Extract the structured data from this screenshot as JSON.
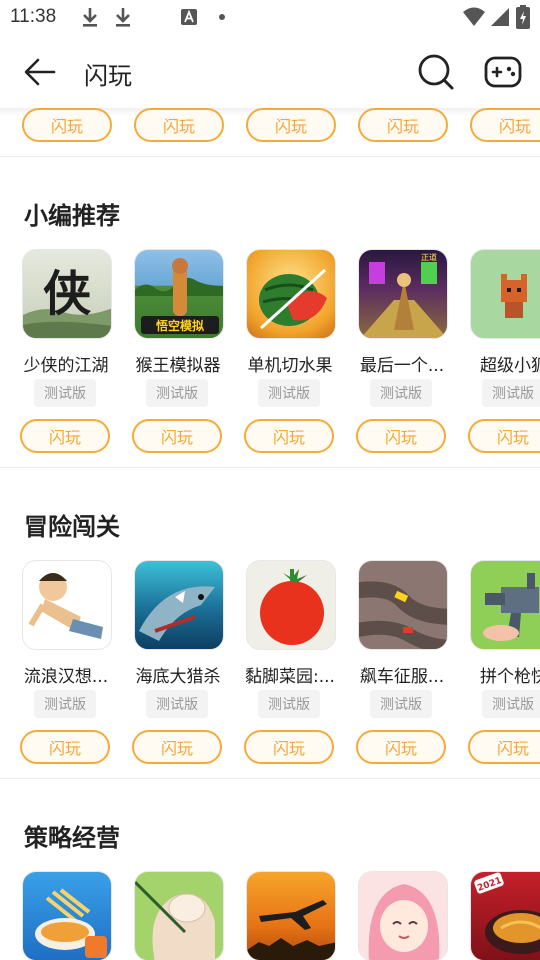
{
  "status": {
    "time": "11:38",
    "icons": [
      "download-icon",
      "download-icon",
      "a-icon",
      "dot-icon",
      "wifi-icon",
      "signal-icon",
      "battery-icon"
    ]
  },
  "header": {
    "title": "闪玩",
    "back_icon": "arrow-left-icon",
    "search_icon": "search-icon",
    "gamepad_icon": "gamepad-icon"
  },
  "colors": {
    "accent": "#f5ab3b",
    "accent_text": "#f5a636",
    "beta_bg": "#f3f3f3"
  },
  "top_row": {
    "buttons": [
      "闪玩",
      "闪玩",
      "闪玩",
      "闪玩",
      "闪玩"
    ]
  },
  "sections": [
    {
      "title": "小编推荐",
      "games": [
        {
          "name": "少侠的江湖",
          "tag": "测试版",
          "play": "闪玩",
          "icon_text": "侠"
        },
        {
          "name": "猴王模拟器",
          "tag": "测试版",
          "play": "闪玩",
          "icon_text": "悟空模拟"
        },
        {
          "name": "单机切水果",
          "tag": "测试版",
          "play": "闪玩"
        },
        {
          "name": "最后一个...",
          "tag": "测试版",
          "play": "闪玩",
          "icon_text": "正道"
        },
        {
          "name": "超级小狐",
          "tag": "测试版",
          "play": "闪玩"
        }
      ]
    },
    {
      "title": "冒险闯关",
      "games": [
        {
          "name": "流浪汉想...",
          "tag": "测试版",
          "play": "闪玩"
        },
        {
          "name": "海底大猎杀",
          "tag": "测试版",
          "play": "闪玩"
        },
        {
          "name": "黏脚菜园:...",
          "tag": "测试版",
          "play": "闪玩"
        },
        {
          "name": "飙车征服...",
          "tag": "测试版",
          "play": "闪玩"
        },
        {
          "name": "拼个枪快",
          "tag": "测试版",
          "play": "闪玩"
        }
      ]
    },
    {
      "title": "策略经营",
      "games": [
        {
          "name": "",
          "tag": "",
          "play": ""
        },
        {
          "name": "",
          "tag": "",
          "play": ""
        },
        {
          "name": "",
          "tag": "",
          "play": ""
        },
        {
          "name": "",
          "tag": "",
          "play": ""
        },
        {
          "name": "",
          "tag": "",
          "play": "",
          "icon_text": "2021"
        }
      ]
    }
  ]
}
